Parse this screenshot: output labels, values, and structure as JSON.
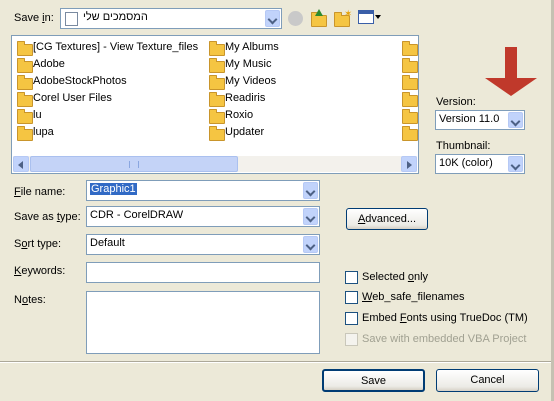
{
  "save_in": {
    "label": "Save in:",
    "value": "המסמכים שלי"
  },
  "files_left": [
    {
      "name": "[CG Textures] - View Texture_files",
      "icon": "folder-icon"
    },
    {
      "name": "Adobe",
      "icon": "folder-icon"
    },
    {
      "name": "AdobeStockPhotos",
      "icon": "folder-icon"
    },
    {
      "name": "Corel User Files",
      "icon": "folder-icon"
    },
    {
      "name": "lu",
      "icon": "folder-icon"
    },
    {
      "name": "lupa",
      "icon": "folder-icon"
    }
  ],
  "files_right": [
    {
      "name": "My Albums",
      "icon": "folder-icon"
    },
    {
      "name": "My Music",
      "icon": "music-folder-icon"
    },
    {
      "name": "My Videos",
      "icon": "video-folder-icon"
    },
    {
      "name": "Readiris",
      "icon": "folder-icon"
    },
    {
      "name": "Roxio",
      "icon": "folder-icon"
    },
    {
      "name": "Updater",
      "icon": "folder-icon"
    }
  ],
  "version": {
    "label": "Version:",
    "value": "Version 11.0"
  },
  "thumbnail": {
    "label": "Thumbnail:",
    "value": "10K (color)"
  },
  "file_name": {
    "label": "File name:",
    "value": "Graphic1"
  },
  "save_as_type": {
    "label": "Save as type:",
    "value": "CDR - CorelDRAW"
  },
  "sort_type": {
    "label": "Sort type:",
    "value": "Default"
  },
  "keywords": {
    "label": "Keywords:",
    "value": ""
  },
  "notes": {
    "label": "Notes:",
    "value": ""
  },
  "advanced_label": "Advanced...",
  "options": {
    "selected_only": "Selected only",
    "web_safe": "Web_safe_filenames",
    "embed_fonts": "Embed Fonts using TrueDoc (TM)",
    "vba": "Save with embedded VBA Project"
  },
  "save_label": "Save",
  "cancel_label": "Cancel",
  "colors": {
    "arrow": "#c0392b",
    "selection": "#316ac5"
  }
}
